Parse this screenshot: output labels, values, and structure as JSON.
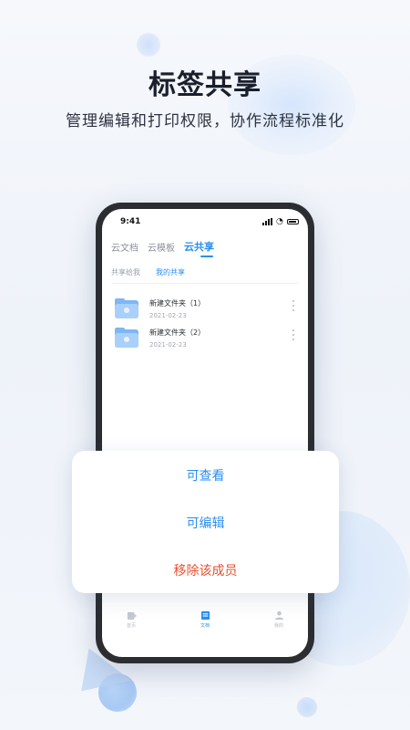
{
  "hero": {
    "title": "标签共享",
    "subtitle": "管理编辑和打印权限，协作流程标准化"
  },
  "phone": {
    "status": {
      "time": "9:41"
    },
    "tabs": [
      {
        "label": "云文档",
        "active": false
      },
      {
        "label": "云模板",
        "active": false
      },
      {
        "label": "云共享",
        "active": true
      }
    ],
    "subtabs": [
      {
        "label": "共享给我",
        "active": false
      },
      {
        "label": "我的共享",
        "active": true
      }
    ],
    "files": [
      {
        "name": "新建文件夹（1）",
        "date": "2021-02-23",
        "icon": "folder-icon"
      },
      {
        "name": "新建文件夹（2）",
        "date": "2021-02-23",
        "icon": "folder-icon"
      }
    ],
    "bottom_nav": [
      {
        "label": "首页",
        "icon": "home-icon",
        "active": false
      },
      {
        "label": "文档",
        "icon": "document-icon",
        "active": true
      },
      {
        "label": "我的",
        "icon": "profile-icon",
        "active": false
      }
    ]
  },
  "sheet": {
    "options": [
      {
        "label": "可查看",
        "style": "primary"
      },
      {
        "label": "可编辑",
        "style": "primary"
      },
      {
        "label": "移除该成员",
        "style": "danger"
      }
    ]
  },
  "colors": {
    "accent": "#2a8ff0",
    "danger": "#e5502d",
    "folder": "#7fb6f3"
  }
}
